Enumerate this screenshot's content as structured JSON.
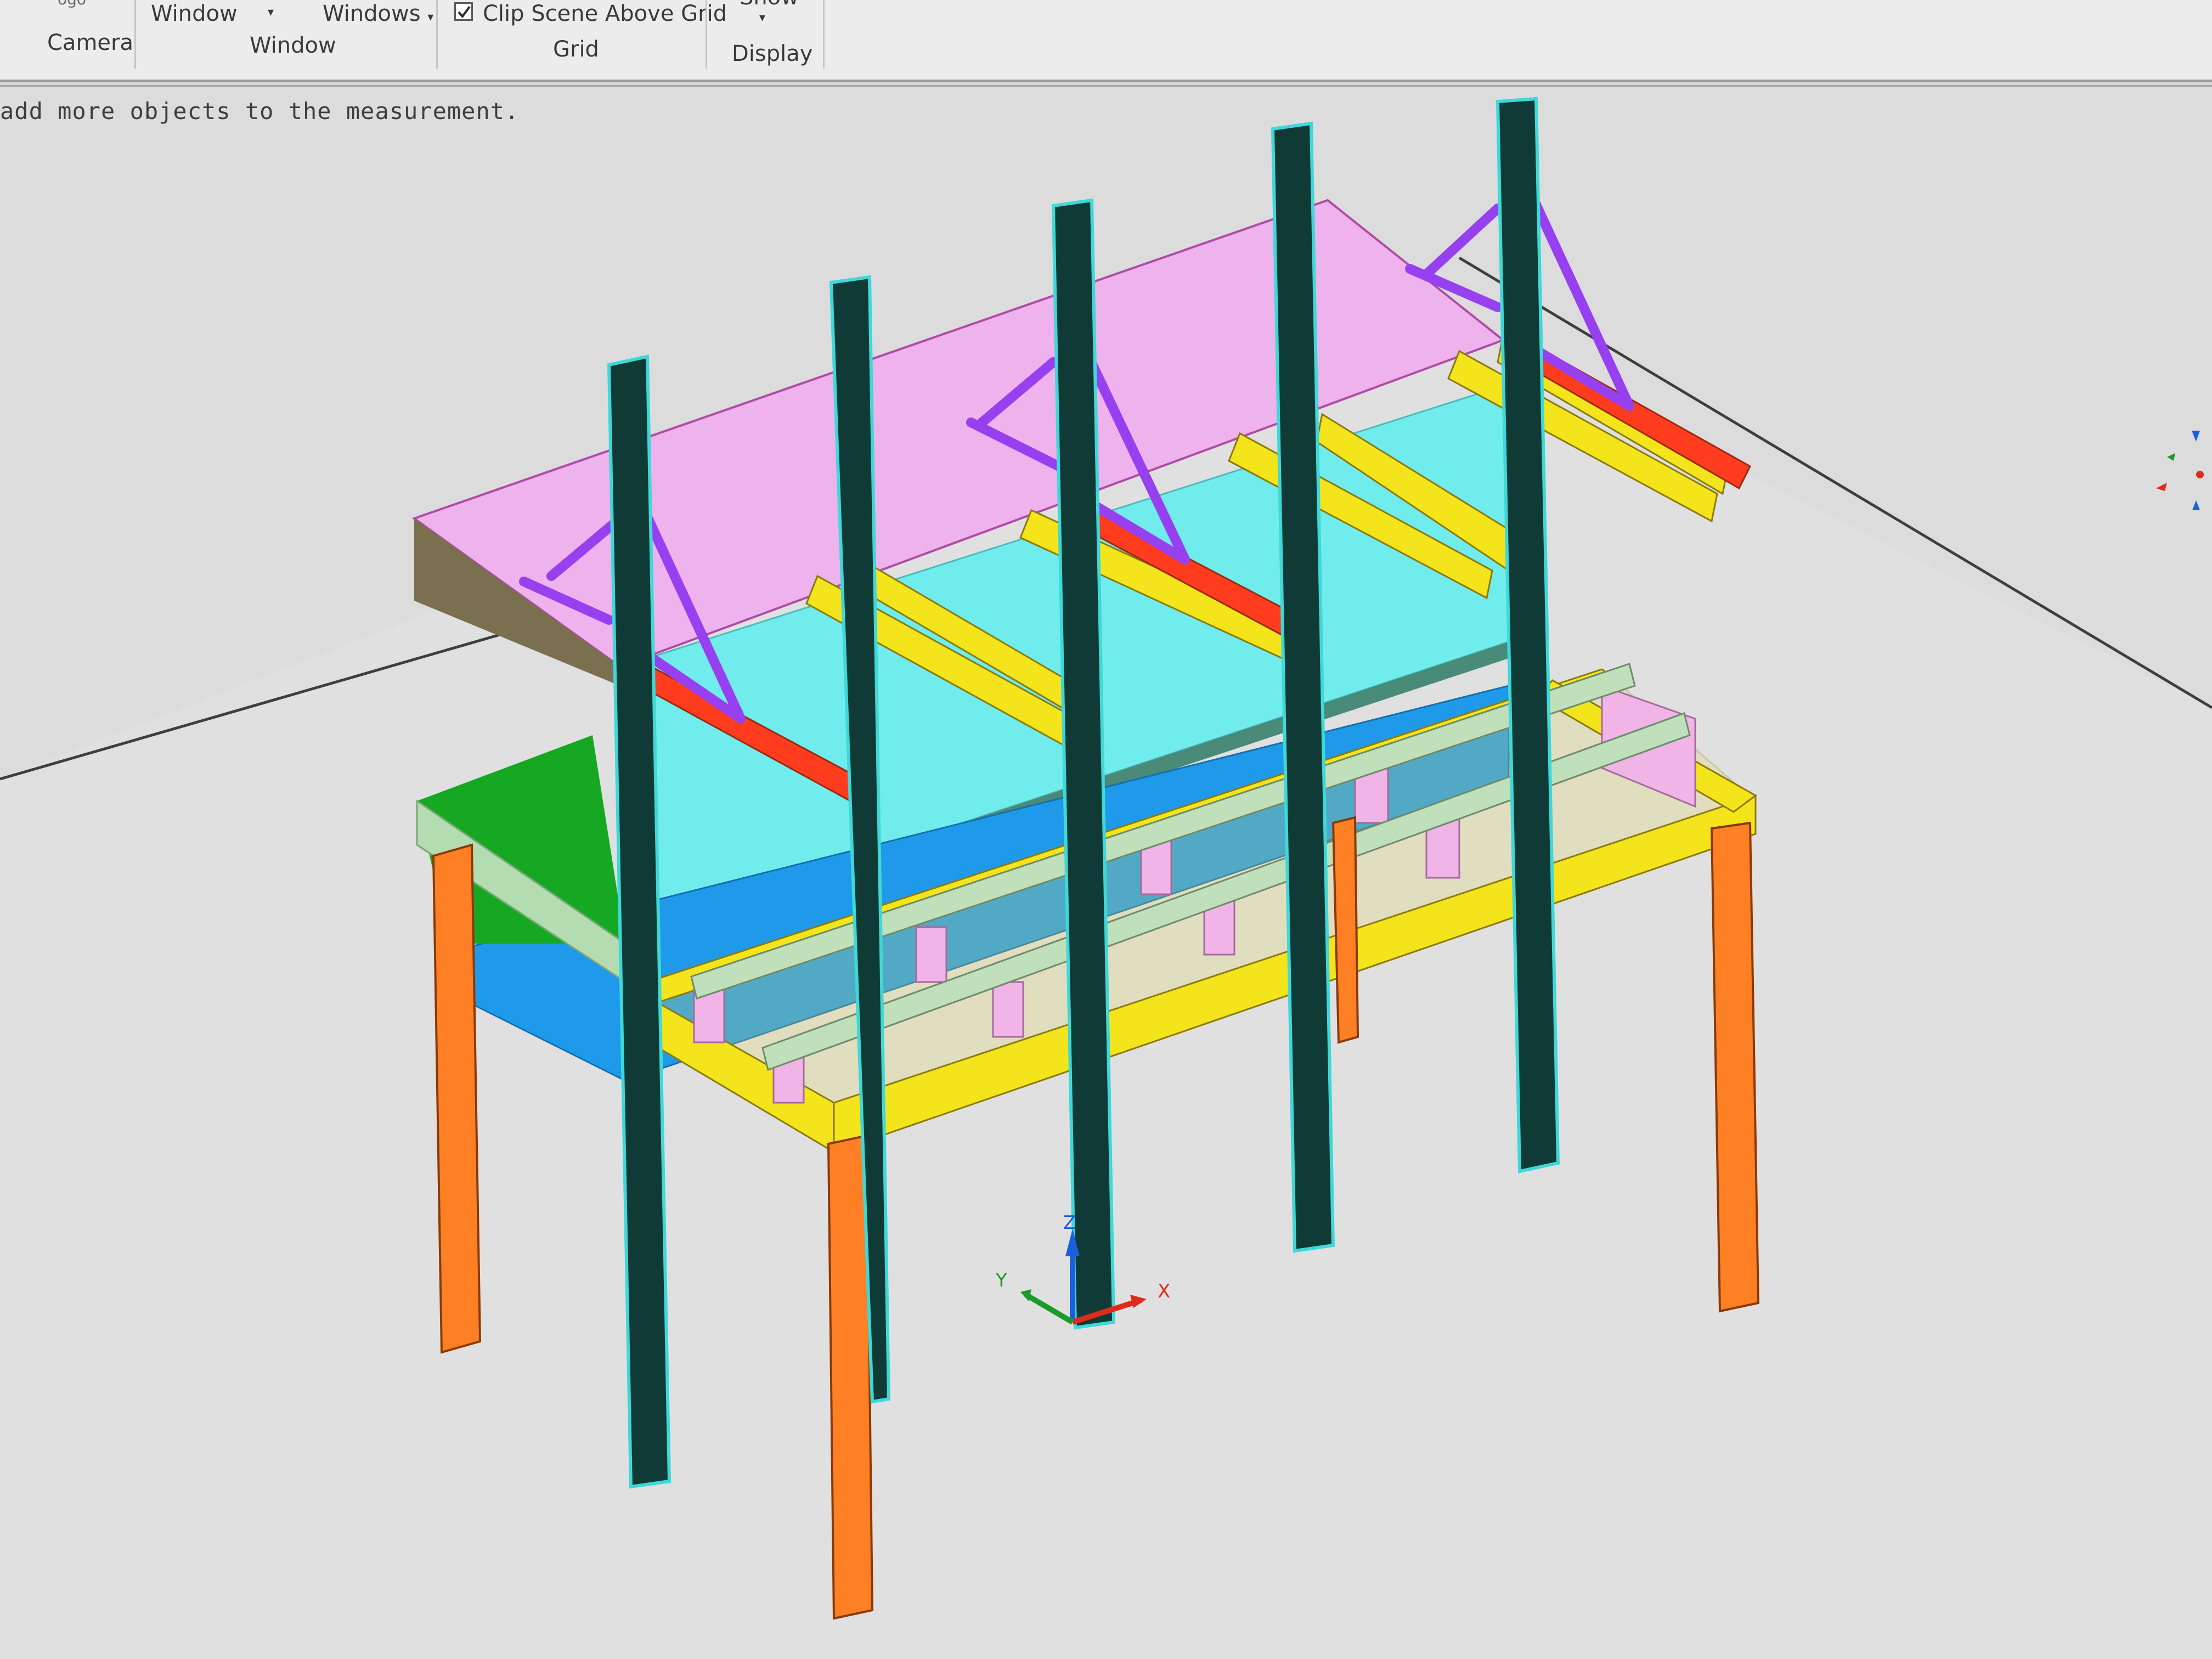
{
  "ribbon": {
    "camera_icon_fragment": "ogo",
    "camera_group_label": "Camera",
    "window_label": "Window",
    "windows_label": "Windows",
    "window_group_label": "Window",
    "clip_scene_label": "Clip Scene Above Grid",
    "grid_group_label": "Grid",
    "show_label": "Show",
    "display_group_label": "Display"
  },
  "status": {
    "message": "add more objects to the measurement."
  },
  "axis_triad": {
    "x_label": "X",
    "y_label": "Y",
    "z_label": "Z"
  },
  "model": {
    "colors": {
      "column": "#0f3a35",
      "column_edge": "#3fd8d8",
      "roof_panel": "#eeb2ec",
      "back_panel": "#70ecec",
      "lower_panel": "#1f9aea",
      "green_deck": "#17a823",
      "green_deck_edge": "#b3dcb0",
      "leg": "#ff7f24",
      "frame": "#f4e41c",
      "rail": "#c0e0bc",
      "pink_block": "#f0b4e6",
      "brace": "#9640ef",
      "red_arm": "#ff3c1e"
    }
  },
  "colors": {
    "ribbon_bg": "#ececec",
    "viewport_bg": "#dcdcdc",
    "grid_line": "#3e3e3e"
  }
}
